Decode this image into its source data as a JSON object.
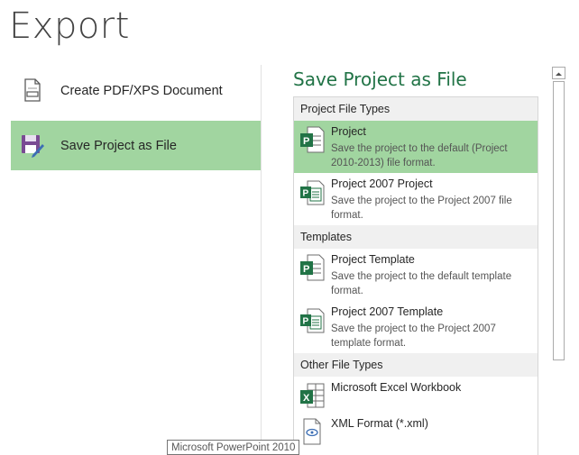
{
  "page": {
    "title": "Export"
  },
  "nav": {
    "items": [
      {
        "label": "Create PDF/XPS Document",
        "icon": "pdf-document-icon",
        "selected": false
      },
      {
        "label": "Save Project as File",
        "icon": "save-project-icon",
        "selected": true
      }
    ]
  },
  "details": {
    "heading": "Save Project as File",
    "groups": [
      {
        "header": "Project File Types",
        "items": [
          {
            "title": "Project",
            "description": "Save the project to the default (Project 2010-2013) file format.",
            "icon": "project-file-icon",
            "selected": true
          },
          {
            "title": "Project 2007 Project",
            "description": "Save the project to the Project 2007 file format.",
            "icon": "project-2007-icon",
            "selected": false
          }
        ]
      },
      {
        "header": "Templates",
        "items": [
          {
            "title": "Project Template",
            "description": "Save the project to the default template format.",
            "icon": "project-template-icon",
            "selected": false
          },
          {
            "title": "Project 2007 Template",
            "description": "Save the project to the Project 2007 template format.",
            "icon": "project-2007-template-icon",
            "selected": false
          }
        ]
      },
      {
        "header": "Other File Types",
        "items": [
          {
            "title": "Microsoft Excel Workbook",
            "description": "",
            "icon": "excel-workbook-icon",
            "selected": false
          },
          {
            "title": "XML Format (*.xml)",
            "description": "",
            "icon": "xml-file-icon",
            "selected": false
          }
        ]
      }
    ]
  },
  "tooltip": {
    "text": "Microsoft PowerPoint 2010"
  },
  "colors": {
    "accent": "#217346",
    "selected_bg": "#a1d5a0",
    "group_bg": "#f0f0f0"
  }
}
